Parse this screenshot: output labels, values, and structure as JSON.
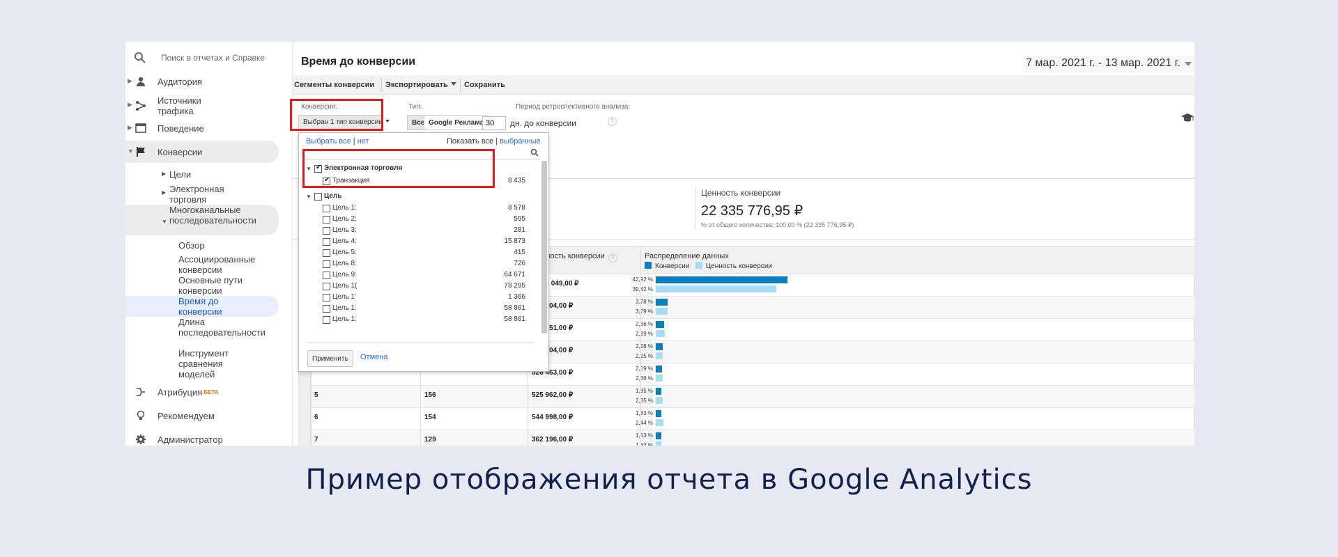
{
  "search": {
    "placeholder": "Поиск в отчетах и Справке"
  },
  "sidebar": {
    "items": [
      {
        "label": "Аудитория",
        "icon": "person-icon"
      },
      {
        "label": "Источники трафика",
        "icon": "fork-icon"
      },
      {
        "label": "Поведение",
        "icon": "window-icon"
      },
      {
        "label": "Конверсии",
        "icon": "flag-icon"
      }
    ],
    "conversions_sub": [
      {
        "label": "Цели"
      },
      {
        "label": "Электронная торговля"
      },
      {
        "label": "Многоканальные последовательности"
      }
    ],
    "multichannel_sub": [
      {
        "label": "Обзор"
      },
      {
        "label": "Ассоциированные конверсии"
      },
      {
        "label": "Основные пути конверсии"
      },
      {
        "label": "Время до конверсии",
        "active": true
      },
      {
        "label": "Длина последовательности"
      },
      {
        "label": "Инструмент сравнения моделей"
      }
    ],
    "bottom": [
      {
        "label": "Атрибуция",
        "badge": "БЕТА",
        "icon": "attribution-icon"
      },
      {
        "label": "Рекомендуем",
        "icon": "lightbulb-icon"
      },
      {
        "label": "Администратор",
        "icon": "gear-icon"
      }
    ]
  },
  "header": {
    "title": "Время до конверсии",
    "date_range": "7 мар. 2021 г. - 13 мар. 2021 г."
  },
  "toolbar": {
    "segments": "Сегменты конверсии",
    "export": "Экспортировать",
    "save": "Сохранить"
  },
  "filters": {
    "conversion_label": "Конверсия:",
    "conversion_value": "Выбран 1 тип конверсии",
    "type_label": "Тип:",
    "type_all": "Все",
    "type_google": "Google Реклама",
    "period_label": "Период ретроспективного анализа:",
    "period_value": "30",
    "period_unit": "дн. до конверсии",
    "help": "?"
  },
  "dropdown": {
    "select_all": "Выбрать все",
    "sep": "|",
    "none": "нет",
    "show_all": "Показать все",
    "selected": "выбранные",
    "groups": [
      {
        "name": "Электронная торговля",
        "checked": true,
        "items": [
          {
            "label": "Транзакция",
            "value": "8 435",
            "checked": true
          }
        ]
      },
      {
        "name": "Цель",
        "checked": false,
        "items": [
          {
            "label": "Цель 1:",
            "value": "8 578"
          },
          {
            "label": "Цель 2:",
            "value": "595"
          },
          {
            "label": "Цель 3:",
            "value": "281"
          },
          {
            "label": "Цель 4:",
            "value": "15 873"
          },
          {
            "label": "Цель 5:",
            "value": "415"
          },
          {
            "label": "Цель 8:",
            "value": "726"
          },
          {
            "label": "Цель 9:",
            "value": "64 671"
          },
          {
            "label": "Цель 1(",
            "value": "78 295"
          },
          {
            "label": "Цель 1'",
            "value": "1 366"
          },
          {
            "label": "Цель 1:",
            "value": "58 861"
          },
          {
            "label": "Цель 1:",
            "value": "58 861"
          }
        ]
      }
    ],
    "apply": "Применить",
    "cancel": "Отмена"
  },
  "summary": {
    "label": "Ценность конверсии",
    "value": "22 335 776,95 ₽",
    "pct": "% от общего количества: 100,00 % (22 335 776,95 ₽)"
  },
  "table": {
    "headers": {
      "value": "Ценность конверсии",
      "dist": "Распределение данных"
    },
    "legend": {
      "conv": "Конверсии",
      "value": "Ценность конверсии"
    },
    "colors": {
      "conv": "#0b7fc4",
      "value": "#a8dcf3"
    },
    "rows": [
      {
        "c1": "",
        "c2": "",
        "c3": "8 804 049,00 ₽",
        "p1": "42,92 %",
        "p2": "39,42 %",
        "v1": 42.92,
        "v2": 39.42
      },
      {
        "c1": "",
        "c2": "",
        "c3": "846 104,00 ₽",
        "p1": "3,78 %",
        "p2": "3,79 %",
        "v1": 3.78,
        "v2": 3.79
      },
      {
        "c1": "",
        "c2": "",
        "c3": "646 051,00 ₽",
        "p1": "2,66 %",
        "p2": "2,89 %",
        "v1": 2.66,
        "v2": 2.89
      },
      {
        "c1": "",
        "c2": "",
        "c3": "502 404,00 ₽",
        "p1": "2,28 %",
        "p2": "2,25 %",
        "v1": 2.28,
        "v2": 2.25
      },
      {
        "c1": "",
        "c2": "",
        "c3": "526 463,00 ₽",
        "p1": "2,09 %",
        "p2": "2,36 %",
        "v1": 2.09,
        "v2": 2.36
      },
      {
        "c1": "5",
        "c2": "156",
        "c3": "525 962,00 ₽",
        "p1": "1,85 %",
        "p2": "2,35 %",
        "v1": 1.85,
        "v2": 2.35
      },
      {
        "c1": "6",
        "c2": "154",
        "c3": "544 998,00 ₽",
        "p1": "1,83 %",
        "p2": "2,44 %",
        "v1": 1.83,
        "v2": 2.44
      },
      {
        "c1": "7",
        "c2": "129",
        "c3": "362 196,00 ₽",
        "p1": "1,53 %",
        "p2": "1,62 %",
        "v1": 1.53,
        "v2": 1.62
      }
    ]
  },
  "caption": "Пример отображения отчета в Google Analytics"
}
